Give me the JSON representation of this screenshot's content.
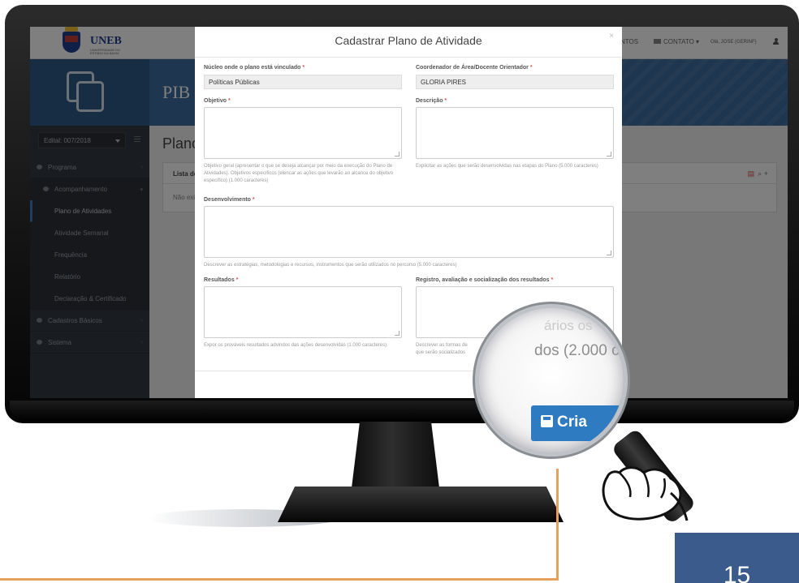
{
  "app": {
    "brand": "UNEB",
    "brand_sub": "UNIVERSIDADE DO ESTADO DA BAHIA",
    "banner_title": "PIB",
    "nav": {
      "eventos": "NTOS",
      "contato": "CONTATO",
      "user": "Olá, JOSE (GERINF)"
    }
  },
  "sidebar": {
    "edital": "Edital: 007/2018",
    "items": [
      {
        "label": "Programa"
      },
      {
        "label": "Acompanhamento"
      },
      {
        "label": "Plano de Atividades"
      },
      {
        "label": "Atividade Semanal"
      },
      {
        "label": "Frequência"
      },
      {
        "label": "Relatório"
      },
      {
        "label": "Declaração & Certificado"
      },
      {
        "label": "Cadastros Básicos"
      },
      {
        "label": "Sistema"
      }
    ]
  },
  "content": {
    "title": "Plano",
    "panel_header": "Lista de",
    "panel_body": "Não exi"
  },
  "modal": {
    "title": "Cadastrar Plano de Atividade",
    "close": "×",
    "nucleo": {
      "label": "Núcleo onde o plano está vinculado",
      "value": "Políticas Públicas"
    },
    "coordenador": {
      "label": "Coordenador de Área/Docente Orientador",
      "value": "GLORIA PIRES"
    },
    "objetivo": {
      "label": "Objetivo",
      "help": "Objetivo geral (apresentar o que se deseja alcançar por meio da execução do Plano de Atividades). Objetivos específicos (elencar as ações que levarão ao alcance do objetivo específico) (1.000 caracteres)"
    },
    "descricao": {
      "label": "Descrição",
      "help": "Explicitar as ações que serão desenvolvidas nas etapas do Plano (5.000 caracteres)"
    },
    "desenvolvimento": {
      "label": "Desenvolvimento",
      "help": "Descrever as estratégias, metodologias e recursos, instrumentos que serão utilizados no percurso (5.000 caracteres)"
    },
    "resultados": {
      "label": "Resultados",
      "help": "Expor os prováveis resultados advindos das ações desenvolvidas (1.000 caracteres)"
    },
    "registro": {
      "label": "Registro, avaliação e socialização dos resultados",
      "help": "Descrever as formas de",
      "help2": "que serão socializados"
    },
    "required_mark": "*"
  },
  "magnifier": {
    "ghost_text": "ários os",
    "text": "dos (2.000 caracte",
    "button": "Cria"
  },
  "slide": {
    "page_number": "15"
  }
}
